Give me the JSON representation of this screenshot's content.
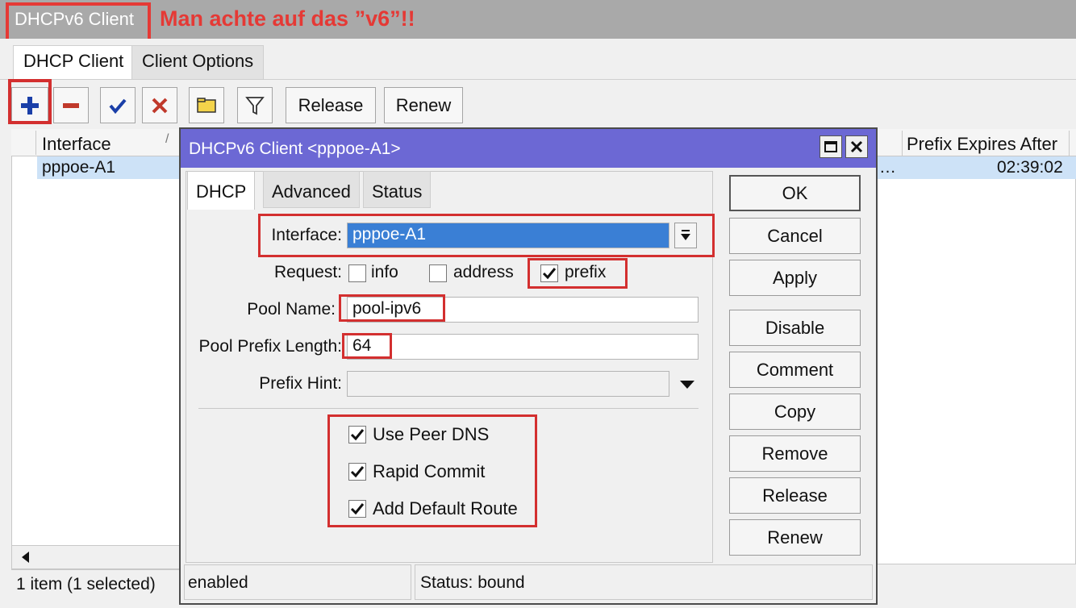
{
  "window": {
    "title": "DHCPv6 Client",
    "annotation": "Man achte auf das ”v6”!!"
  },
  "main_tabs": [
    {
      "label": "DHCP Client"
    },
    {
      "label": "Client Options"
    }
  ],
  "toolbar": {
    "add_icon": "plus-icon",
    "remove_icon": "minus-icon",
    "enable_icon": "check-icon",
    "disable_icon": "x-icon",
    "comment_icon": "note-icon",
    "filter_icon": "filter-icon",
    "release_label": "Release",
    "renew_label": "Renew"
  },
  "list": {
    "columns": {
      "interface": "Interface",
      "prefix_expires": "Prefix Expires After"
    },
    "rows": [
      {
        "interface": "pppoe-A1",
        "truncated": "…",
        "prefix_expires": "02:39:02"
      }
    ],
    "status": "1 item (1 selected)"
  },
  "dialog": {
    "title": "DHCPv6 Client <pppoe-A1>",
    "tabs": [
      {
        "label": "DHCP"
      },
      {
        "label": "Advanced"
      },
      {
        "label": "Status"
      }
    ],
    "form": {
      "interface_label": "Interface:",
      "interface_value": "pppoe-A1",
      "request_label": "Request:",
      "request_info": "info",
      "request_address": "address",
      "request_prefix": "prefix",
      "pool_name_label": "Pool Name:",
      "pool_name_value": "pool-ipv6",
      "pool_prefix_length_label": "Pool Prefix Length:",
      "pool_prefix_length_value": "64",
      "prefix_hint_label": "Prefix Hint:",
      "prefix_hint_value": "",
      "use_peer_dns": "Use Peer DNS",
      "rapid_commit": "Rapid Commit",
      "add_default_route": "Add Default Route"
    },
    "buttons": {
      "ok": "OK",
      "cancel": "Cancel",
      "apply": "Apply",
      "disable": "Disable",
      "comment": "Comment",
      "copy": "Copy",
      "remove": "Remove",
      "release": "Release",
      "renew": "Renew"
    },
    "status_left": "enabled",
    "status_right": "Status: bound"
  },
  "colors": {
    "highlight_red": "#d32f2f",
    "dialog_title_bg": "#6c68d4",
    "selection_bg": "#cde2f7",
    "input_selected_bg": "#3a7fd5"
  }
}
